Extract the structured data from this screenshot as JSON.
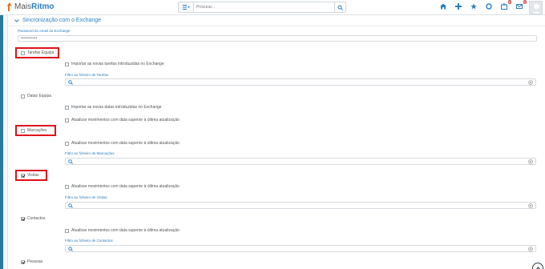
{
  "app": {
    "logo_prefix": "Mais",
    "logo_suffix": "Ritmo"
  },
  "search": {
    "placeholder": "Procurar..."
  },
  "badges": {
    "tasks": "9",
    "messages": "0"
  },
  "section": {
    "title": "Sincronização com o Exchange",
    "password_label": "Password do email do Exchange",
    "password_value": "••••••••••"
  },
  "groups": [
    {
      "label": "Tarefas Equipa",
      "checked": false,
      "options": [
        "Importar as novas tarefas introduzidas no Exchange"
      ],
      "filter_label": "Filtro ao ficheiro de Tarefas"
    },
    {
      "label": "Datas Equipa",
      "checked": false,
      "options": [
        "Importar as novas datas introduzidas no Exchange",
        "Atualizar movimentos com data superior à última atualização"
      ],
      "filter_label": ""
    },
    {
      "label": "Marcações",
      "checked": false,
      "options": [
        "Atualizar movimentos com data superior à última atualização"
      ],
      "filter_label": "Filtro ao ficheiro de Marcações"
    },
    {
      "label": "Visitas",
      "checked": true,
      "options": [
        "Atualizar movimentos com data superior à última atualização"
      ],
      "filter_label": "Filtro ao ficheiro de Visitas"
    },
    {
      "label": "Contactos",
      "checked": true,
      "options": [
        "Atualizar movimentos com data superior à última atualização"
      ],
      "filter_label": "Filtro ao ficheiro de Contactos"
    },
    {
      "label": "Pessoas",
      "checked": true,
      "options": [],
      "filter_label": ""
    }
  ],
  "colors": {
    "accent": "#2a7fc1",
    "highlight": "#e0101a",
    "left_strip": "#2a7a9b"
  }
}
